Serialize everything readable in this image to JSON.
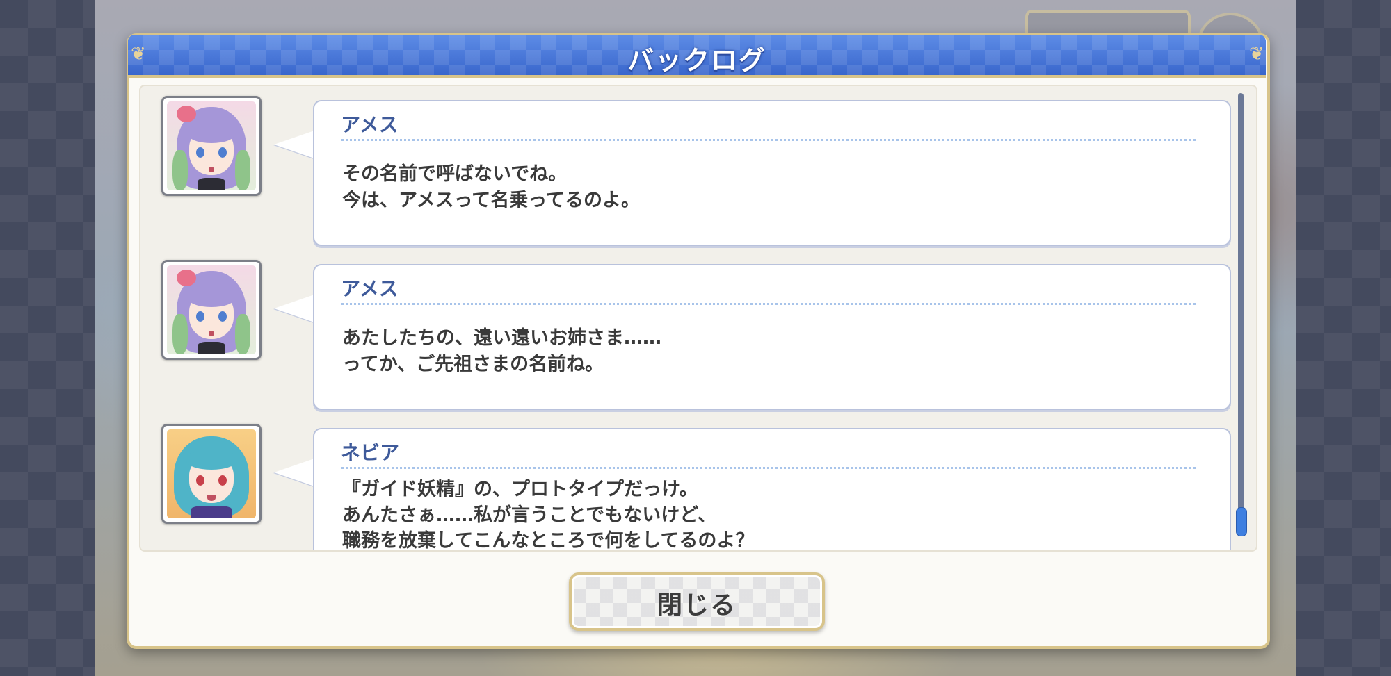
{
  "dialog": {
    "title": "バックログ",
    "close_label": "閉じる"
  },
  "entries": [
    {
      "speaker": "アメス",
      "avatar": "amesu-portrait",
      "lines": [
        "その名前で呼ばないでね。",
        "今は、アメスって名乗ってるのよ。"
      ]
    },
    {
      "speaker": "アメス",
      "avatar": "amesu-portrait",
      "lines": [
        "あたしたちの、遠い遠いお姉さま……",
        "ってか、ご先祖さまの名前ね。"
      ]
    },
    {
      "speaker": "ネビア",
      "avatar": "nebia-portrait",
      "lines": [
        "『ガイド妖精』の、プロトタイプだっけ。",
        "あんたさぁ……私が言うことでもないけど、",
        "職務を放棄してこんなところで何をしてるのよ？"
      ]
    }
  ],
  "colors": {
    "title_bar": "#3e6fd3",
    "frame_gold": "#d8c48a",
    "speaker_name": "#3e5a9a",
    "scroll_thumb": "#3e7fe0"
  },
  "scroll_position": 1.0
}
